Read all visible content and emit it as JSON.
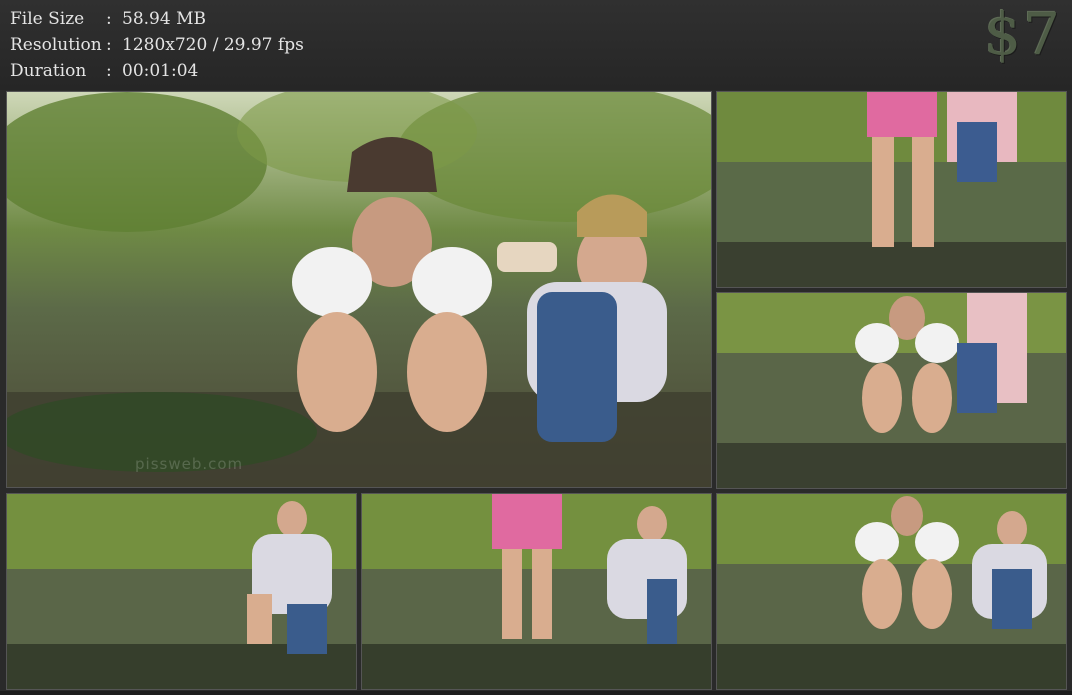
{
  "info": {
    "file_size_label": "File Size",
    "file_size_value": "58.94 MB",
    "resolution_label": "Resolution",
    "resolution_value": "1280x720 / 29.97 fps",
    "duration_label": "Duration",
    "duration_value": "00:01:04",
    "separator": ":"
  },
  "price": "$7",
  "watermark": "pissweb.com",
  "colors": {
    "background": "#2a2a2a",
    "price": "#4e5c46",
    "foliage": "#5f7a3a",
    "ground": "#5b5a48"
  },
  "thumbnails": [
    {
      "name": "frame-main",
      "icon": "video-frame"
    },
    {
      "name": "frame-2",
      "icon": "video-frame"
    },
    {
      "name": "frame-3",
      "icon": "video-frame"
    },
    {
      "name": "frame-4",
      "icon": "video-frame"
    },
    {
      "name": "frame-5",
      "icon": "video-frame"
    },
    {
      "name": "frame-6",
      "icon": "video-frame"
    }
  ]
}
